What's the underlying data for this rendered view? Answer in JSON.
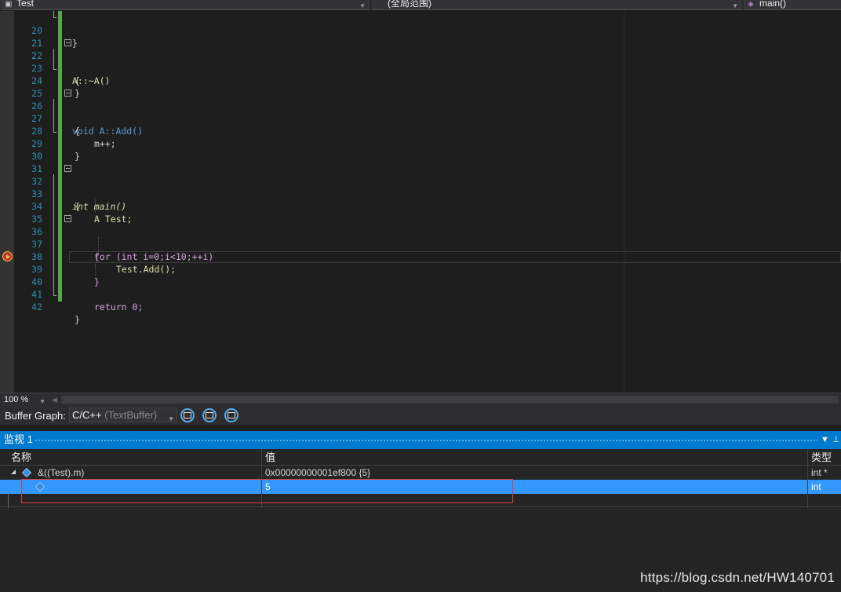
{
  "nav": {
    "project": "Test",
    "scope": "(全局范围)",
    "member": "main()"
  },
  "editor": {
    "lines": [
      {
        "num": "20",
        "code": "}"
      },
      {
        "num": "21",
        "code": ""
      },
      {
        "num": "22",
        "code": "A::~A()"
      },
      {
        "num": "23",
        "code": "{"
      },
      {
        "num": "24",
        "code": "}"
      },
      {
        "num": "25",
        "code": ""
      },
      {
        "num": "26",
        "code": "void A::Add()"
      },
      {
        "num": "27",
        "code": "{"
      },
      {
        "num": "28",
        "code": "m++;"
      },
      {
        "num": "29",
        "code": "}"
      },
      {
        "num": "30",
        "code": ""
      },
      {
        "num": "31",
        "code": ""
      },
      {
        "num": "32",
        "code": "int main()"
      },
      {
        "num": "33",
        "code": "{"
      },
      {
        "num": "34",
        "code": "A Test;"
      },
      {
        "num": "35",
        "code": ""
      },
      {
        "num": "36",
        "code": "for (int i=0;i<10;++i)"
      },
      {
        "num": "37",
        "code": "{"
      },
      {
        "num": "38",
        "code": "Test.Add();"
      },
      {
        "num": "39",
        "code": "}"
      },
      {
        "num": "40",
        "code": ""
      },
      {
        "num": "41",
        "code": "return 0;"
      },
      {
        "num": "42",
        "code": "}"
      }
    ]
  },
  "zoom": {
    "level": "100 %"
  },
  "buffer_graph": {
    "label": "Buffer Graph:",
    "content_type": "C/C++",
    "buffer": "(TextBuffer)"
  },
  "watch": {
    "title": "监视 1",
    "columns": {
      "name": "名称",
      "value": "值",
      "type": "类型"
    },
    "rows": [
      {
        "name": "&((Test).m)",
        "value": "0x00000000001ef800 {5}",
        "type": "int *"
      },
      {
        "name": "",
        "value": "5",
        "type": "int"
      }
    ]
  },
  "watermark": "https://blog.csdn.net/HW140701",
  "colors": {
    "accent": "#007acc",
    "selection": "#3399ff",
    "highlight_box": "#e03b3b",
    "change_bar": "#57a64a"
  }
}
